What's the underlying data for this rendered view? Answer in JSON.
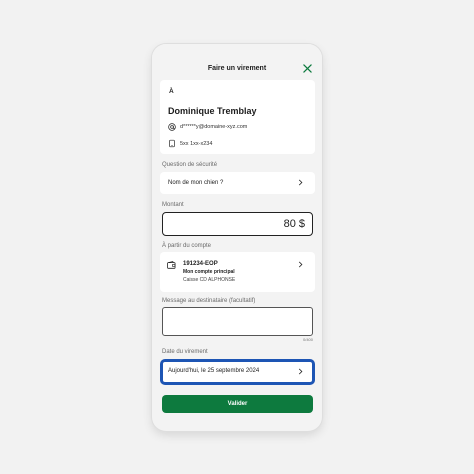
{
  "header": {
    "title": "Faire un virement"
  },
  "recipient": {
    "section_label": "À",
    "name": "Dominique Tremblay",
    "email": "d******y@domaine-xyz.com",
    "phone": "5xx 1xx-x234"
  },
  "security": {
    "label": "Question de sécurité",
    "value": "Nom de mon chien ?"
  },
  "amount": {
    "label": "Montant",
    "value": "80 $"
  },
  "account": {
    "label": "À partir du compte",
    "number": "191234-EOP",
    "name": "Mon compte principal",
    "institution": "Caisse CD ALPHONSE"
  },
  "message": {
    "label": "Message au destinataire (facultatif)",
    "counter": "0/400"
  },
  "date": {
    "label": "Date du virement",
    "value": "Aujourd'hui, le 25 septembre 2024"
  },
  "submit": {
    "label": "Valider"
  },
  "colors": {
    "primary": "#0d7a3e",
    "focus": "#1d55b4"
  }
}
